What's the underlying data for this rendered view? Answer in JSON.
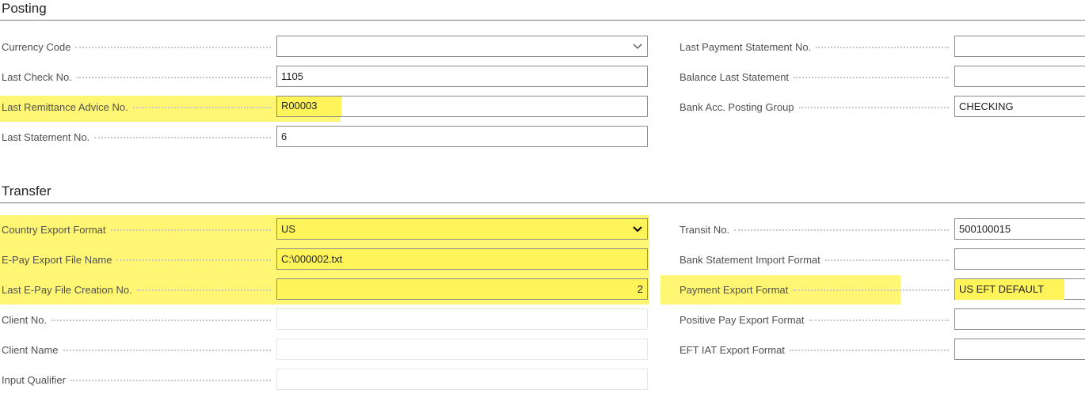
{
  "posting": {
    "title": "Posting",
    "left": [
      {
        "label": "Currency Code",
        "value": "",
        "type": "select-outline"
      },
      {
        "label": "Last Check No.",
        "value": "1105"
      },
      {
        "label": "Last Remittance Advice No.",
        "value": "R00003"
      },
      {
        "label": "Last Statement No.",
        "value": "6"
      }
    ],
    "right": [
      {
        "label": "Last Payment Statement No.",
        "value": ""
      },
      {
        "label": "Balance Last Statement",
        "value": ""
      },
      {
        "label": "Bank Acc. Posting Group",
        "value": "CHECKING"
      }
    ]
  },
  "transfer": {
    "title": "Transfer",
    "left": [
      {
        "label": "Country Export Format",
        "value": "US",
        "type": "select"
      },
      {
        "label": "E-Pay Export File Name",
        "value": "C:\\000002.txt"
      },
      {
        "label": "Last E-Pay File Creation No.",
        "value": "2"
      },
      {
        "label": "Client No.",
        "value": ""
      },
      {
        "label": "Client Name",
        "value": ""
      },
      {
        "label": "Input Qualifier",
        "value": ""
      }
    ],
    "right": [
      {
        "label": "Transit No.",
        "value": "500100015"
      },
      {
        "label": "Bank Statement Import Format",
        "value": ""
      },
      {
        "label": "Payment Export Format",
        "value": "US EFT DEFAULT"
      },
      {
        "label": "Positive Pay Export Format",
        "value": ""
      },
      {
        "label": "EFT IAT Export Format",
        "value": ""
      }
    ]
  },
  "colors": {
    "highlight": "#fff55a"
  },
  "icons": {
    "dropdown": "chevron-down-icon"
  }
}
